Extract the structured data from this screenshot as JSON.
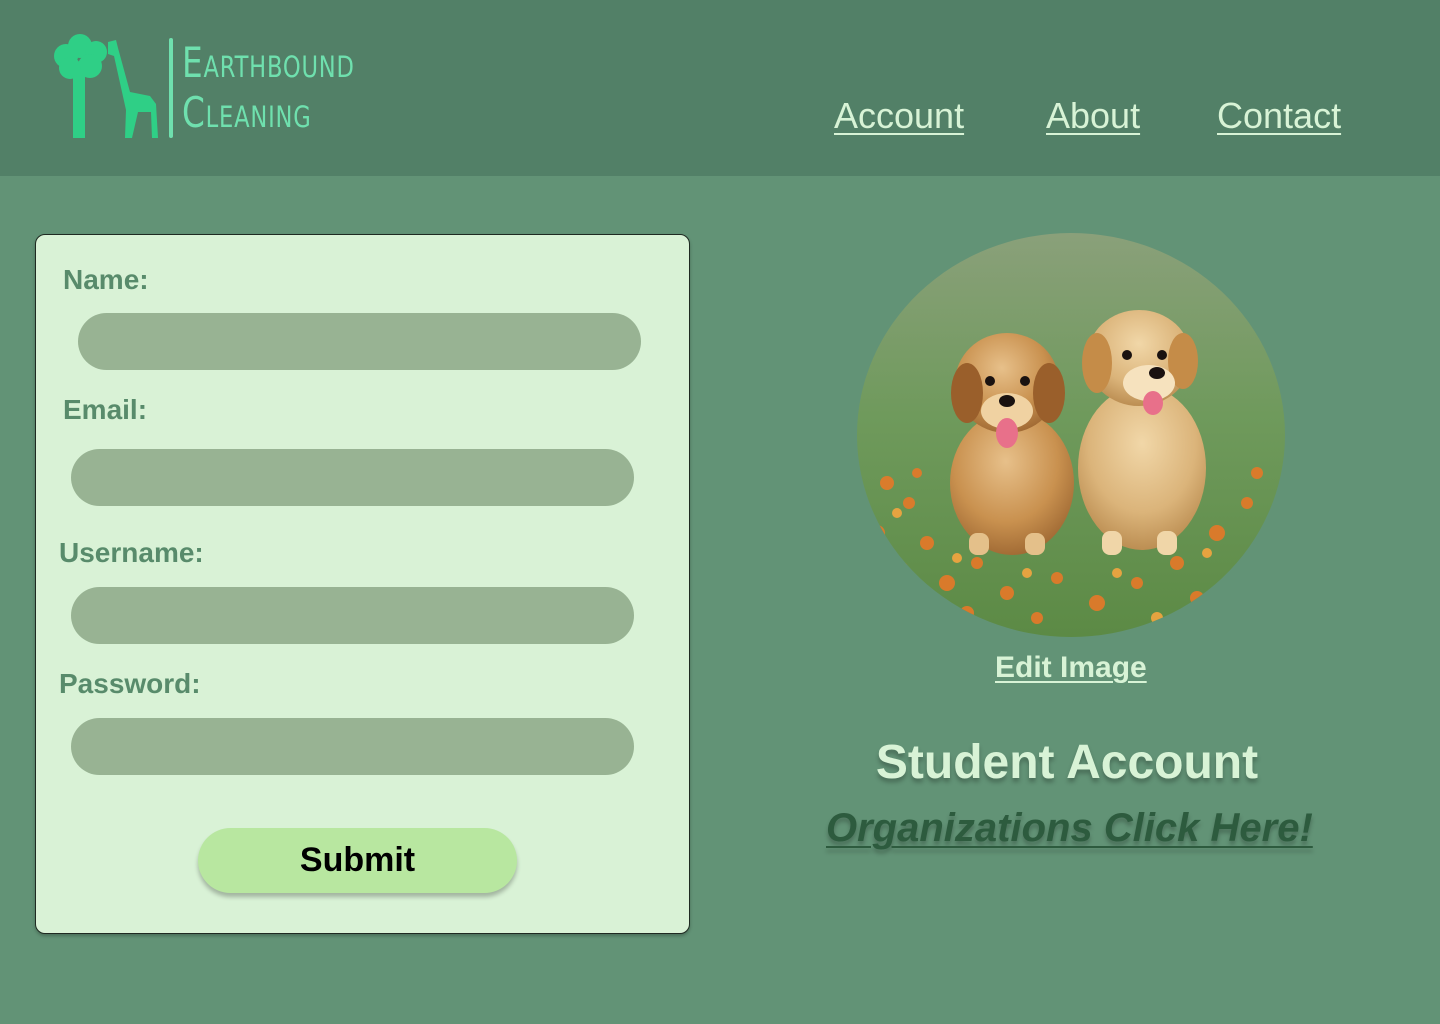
{
  "header": {
    "logo": {
      "line1": "Earthbound",
      "line2": "Cleaning",
      "icon": "tree-giraffe-logo-icon",
      "color": "#6fe0ae"
    },
    "nav": {
      "account": "Account",
      "about": "About",
      "contact": "Contact"
    }
  },
  "form": {
    "name_label": "Name:",
    "email_label": "Email:",
    "username_label": "Username:",
    "password_label": "Password:",
    "name_value": "",
    "email_value": "",
    "username_value": "",
    "password_value": "",
    "submit_label": "Submit"
  },
  "profile": {
    "image_description": "two golden retriever puppies in a field of orange flowers",
    "edit_image_label": "Edit Image",
    "account_type": "Student Account",
    "organizations_link": "Organizations Click Here!"
  },
  "colors": {
    "page_bg": "#629376",
    "header_bg": "#528067",
    "card_bg": "#d9f2d6",
    "input_bg": "#98b393",
    "label": "#588b6b",
    "button_bg": "#b8e7a0",
    "light_text": "#d8f3d6",
    "dark_link": "#2d5b3e"
  }
}
